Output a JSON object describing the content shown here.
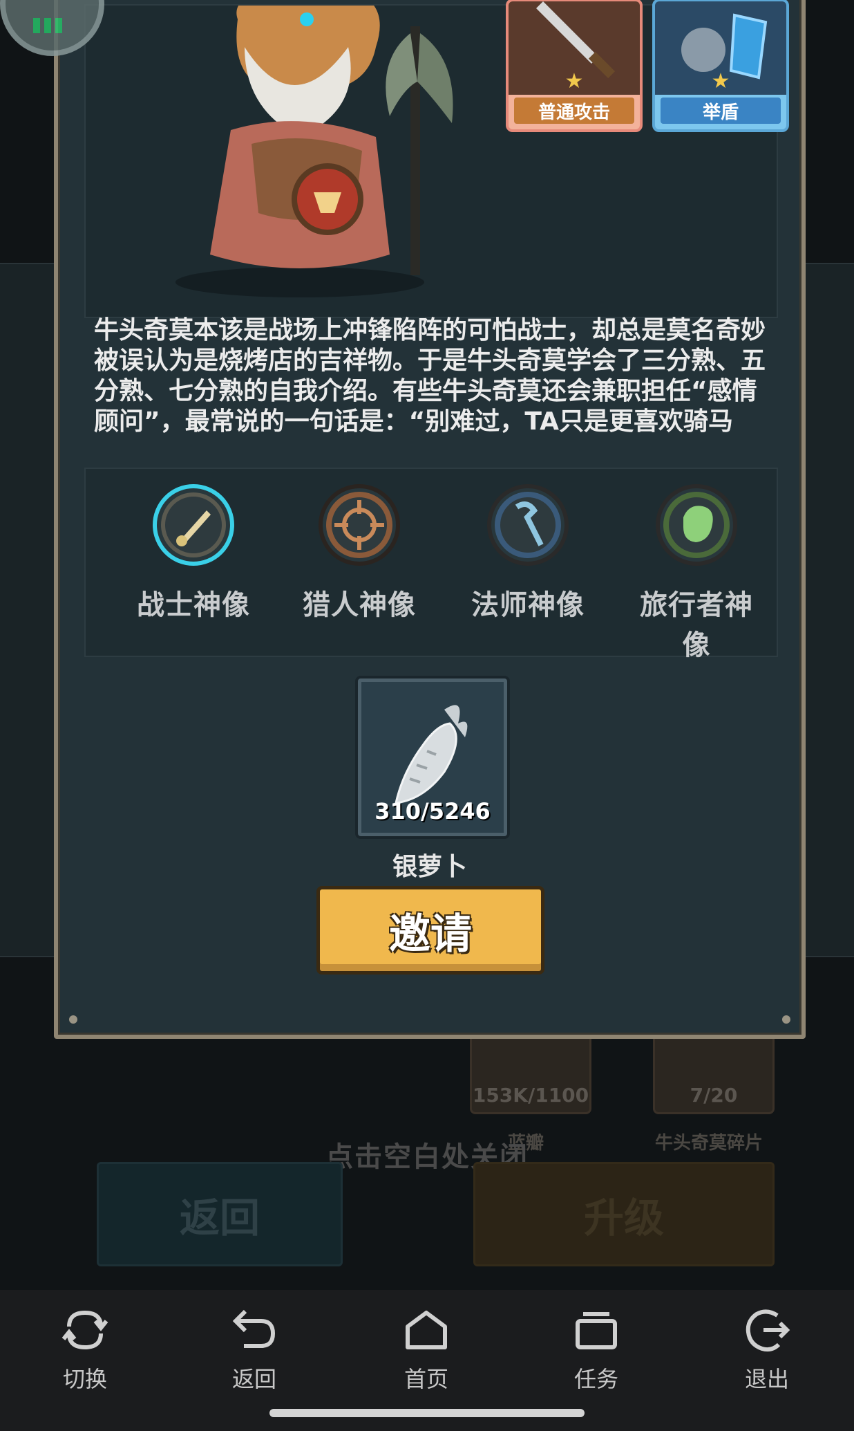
{
  "background": {
    "items": [
      {
        "count": "153K/1100",
        "label": "蓝瓣"
      },
      {
        "count": "7/20",
        "label": "牛头奇莫碎片"
      }
    ],
    "close_hint": "点击空白处关闭",
    "back_button": "返回",
    "upgrade_button": "升级"
  },
  "modal": {
    "skills": [
      {
        "label": "普通攻击",
        "icon": "sword-icon"
      },
      {
        "label": "举盾",
        "icon": "shield-knight-icon"
      }
    ],
    "description": "牛头奇莫本该是战场上冲锋陷阵的可怕战士，却总是莫名奇妙被误认为是烧烤店的吉祥物。于是牛头奇莫学会了三分熟、五分熟、七分熟的自我介绍。有些牛头奇莫还会兼职担任“感情顾问”，最常说的一句话是：“别难过，TA只是更喜欢骑马",
    "statues": [
      {
        "name": "战士神像",
        "icon": "sword-icon",
        "color": "#d9c27a",
        "ring": "#3ad0e8",
        "selected": true
      },
      {
        "name": "猎人神像",
        "icon": "crosshair-icon",
        "color": "#c98a5a",
        "ring": "#7a4a2a",
        "selected": false
      },
      {
        "name": "法师神像",
        "icon": "staff-icon",
        "color": "#8fc6e0",
        "ring": "#3a5a7a",
        "selected": false
      },
      {
        "name": "旅行者神像",
        "icon": "fist-icon",
        "color": "#8ed07a",
        "ring": "#4a6a3a",
        "selected": false
      }
    ],
    "resource": {
      "count": "310/5246",
      "name": "银萝卜",
      "icon": "silver-carrot-icon"
    },
    "invite_button": "邀请"
  },
  "navbar": {
    "items": [
      {
        "label": "切换",
        "icon": "switch-icon"
      },
      {
        "label": "返回",
        "icon": "back-arrow-icon"
      },
      {
        "label": "首页",
        "icon": "home-icon"
      },
      {
        "label": "任务",
        "icon": "tasks-icon"
      },
      {
        "label": "退出",
        "icon": "exit-icon"
      }
    ]
  }
}
